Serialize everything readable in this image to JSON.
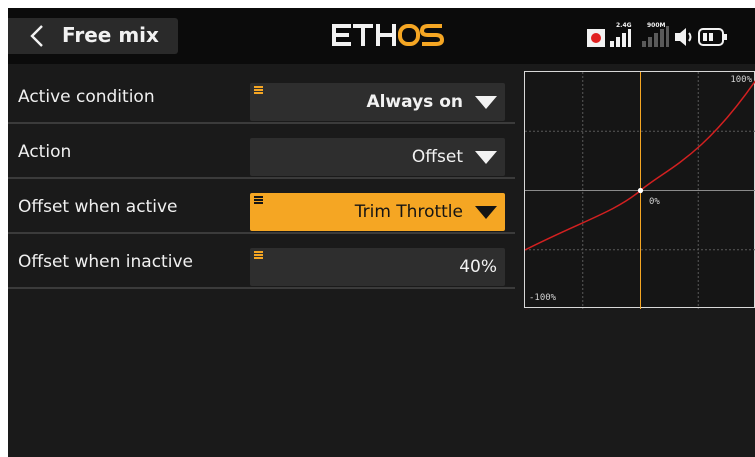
{
  "header": {
    "title": "Free mix",
    "brand": "ETHOS",
    "status": {
      "signal_24_label": "2.4G",
      "signal_900_label": "900M",
      "recording_color": "#e02020"
    }
  },
  "settings": [
    {
      "label": "Active condition",
      "value": "Always on",
      "has_dropdown": true,
      "bold": true,
      "highlighted": false
    },
    {
      "label": "Action",
      "value": "Offset",
      "has_dropdown": true,
      "bold": false,
      "highlighted": false
    },
    {
      "label": "Offset when active",
      "value": "Trim Throttle",
      "has_dropdown": true,
      "bold": false,
      "highlighted": true
    },
    {
      "label": "Offset when inactive",
      "value": "40%",
      "has_dropdown": false,
      "bold": false,
      "highlighted": false
    }
  ],
  "curve": {
    "label_top_right": "100%",
    "label_center": "0%",
    "label_bottom_left": "-100%",
    "curve_color": "#d22020",
    "marker_line_color": "#f5a623"
  },
  "colors": {
    "accent": "#f5a623",
    "background": "#1a1a1a",
    "field_bg": "#2e2e2e"
  }
}
